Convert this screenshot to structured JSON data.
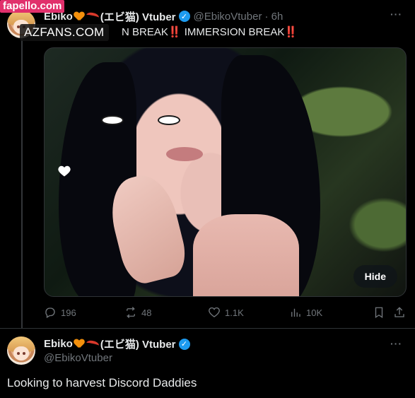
{
  "watermarks": {
    "fapello": "fapello.com",
    "azfans": "AZFANS.COM"
  },
  "tweet1": {
    "display_name_prefix": "Ebiko",
    "display_name_suffix": "(エビ猫) Vtuber",
    "handle": "@EbikoVtuber",
    "time": "· 6h",
    "text_part1": "N BREAK",
    "bang1": "‼️",
    "text_part2": " IMMERSION BREAK",
    "bang2": "‼️",
    "hide_label": "Hide",
    "more": "···",
    "stats": {
      "replies": "196",
      "reposts": "48",
      "likes": "1.1K",
      "views": "10K"
    }
  },
  "tweet2": {
    "display_name_prefix": "Ebiko",
    "display_name_suffix": "(エビ猫) Vtuber",
    "handle": "@EbikoVtuber",
    "more": "···",
    "text": "Looking to harvest Discord Daddies"
  },
  "icons": [
    "verified-badge-icon",
    "reply-icon",
    "repost-icon",
    "like-icon",
    "views-icon",
    "bookmark-icon",
    "share-icon",
    "more-icon",
    "heart-icon"
  ],
  "colors": {
    "background": "#000000",
    "text": "#e7e9ea",
    "muted": "#71767b",
    "verified": "#1d9bf0",
    "divider": "#2f3336"
  }
}
